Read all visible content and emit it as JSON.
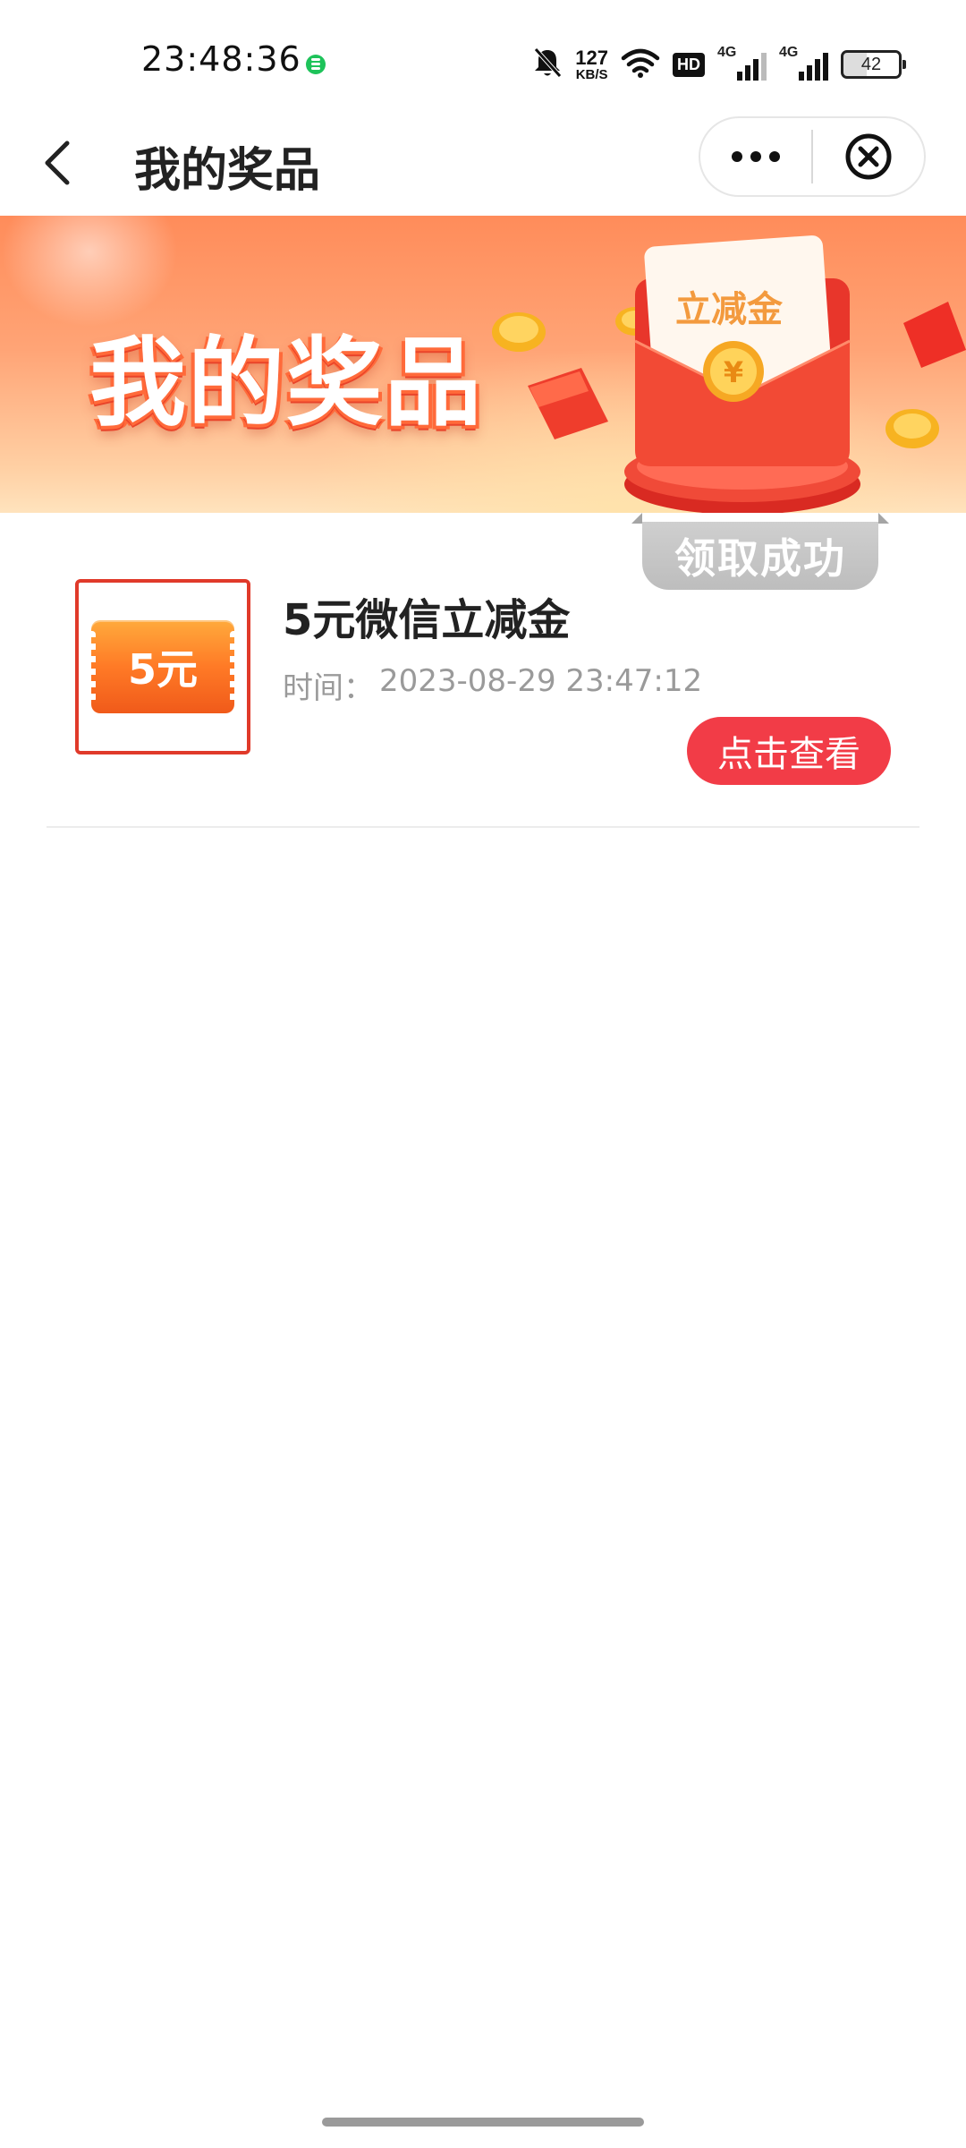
{
  "status_bar": {
    "time": "23:48:36",
    "net_speed_value": "127",
    "net_speed_unit": "KB/S",
    "hd_label": "HD",
    "signal1_label": "4G",
    "signal2_label": "4G",
    "battery": "42",
    "icons": [
      "message-dot-icon",
      "mute-bell-icon",
      "wifi-icon",
      "hd-icon",
      "signal-icon",
      "battery-icon"
    ]
  },
  "nav": {
    "title": "我的奖品",
    "icons": [
      "back-icon",
      "more-icon",
      "close-icon"
    ]
  },
  "banner": {
    "title": "我的奖品",
    "envelope_label": "立减金",
    "colors": {
      "top": "#ff8c5a",
      "bottom": "#ffe3bd",
      "envelope": "#ee3b2d"
    }
  },
  "prizes": [
    {
      "thumb_label": "5元",
      "name": "5元微信立减金",
      "time_label": "时间：",
      "time_value": "2023-08-29 23:47:12",
      "status": "领取成功",
      "action": "点击查看"
    }
  ],
  "colors": {
    "accent": "#f23c47",
    "thumb_border": "#e03a2a",
    "coupon": "#ff7a26",
    "status_gray": "#bdbdbd"
  }
}
